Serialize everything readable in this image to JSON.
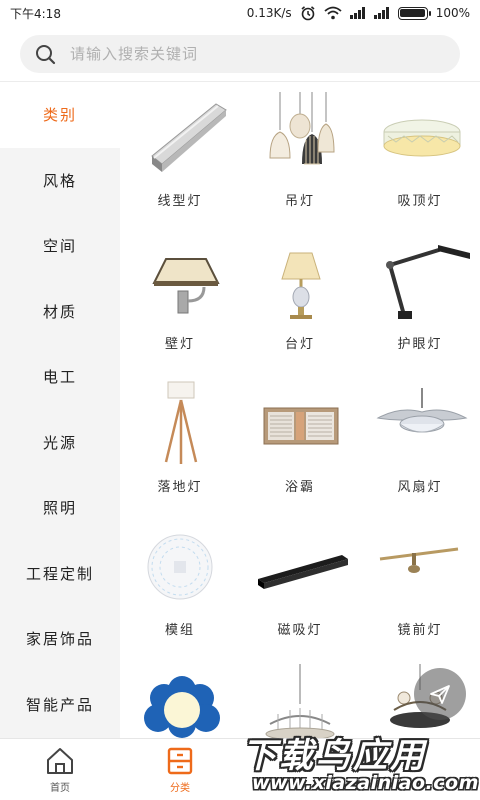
{
  "status_bar": {
    "time": "下午4:18",
    "net_speed": "0.13K/s",
    "battery_text": "100%",
    "battery_level": 1.0
  },
  "search": {
    "placeholder": "请输入搜索关键词"
  },
  "sidebar": {
    "items": [
      {
        "label": "类别",
        "active": true
      },
      {
        "label": "风格"
      },
      {
        "label": "空间"
      },
      {
        "label": "材质"
      },
      {
        "label": "电工"
      },
      {
        "label": "光源"
      },
      {
        "label": "照明"
      },
      {
        "label": "工程定制"
      },
      {
        "label": "家居饰品"
      },
      {
        "label": "智能产品"
      }
    ]
  },
  "products": [
    {
      "label": "线型灯",
      "icon": "linear-light-icon"
    },
    {
      "label": "吊灯",
      "icon": "pendant-light-icon"
    },
    {
      "label": "吸顶灯",
      "icon": "ceiling-light-icon"
    },
    {
      "label": "壁灯",
      "icon": "wall-lamp-icon"
    },
    {
      "label": "台灯",
      "icon": "table-lamp-icon"
    },
    {
      "label": "护眼灯",
      "icon": "desk-arm-lamp-icon"
    },
    {
      "label": "落地灯",
      "icon": "floor-lamp-icon"
    },
    {
      "label": "浴霸",
      "icon": "bath-heater-icon"
    },
    {
      "label": "风扇灯",
      "icon": "fan-light-icon"
    },
    {
      "label": "模组",
      "icon": "led-module-icon"
    },
    {
      "label": "磁吸灯",
      "icon": "magnetic-track-icon"
    },
    {
      "label": "镜前灯",
      "icon": "mirror-light-icon"
    },
    {
      "label": "",
      "icon": "kids-light-icon"
    },
    {
      "label": "",
      "icon": "chandelier-icon"
    },
    {
      "label": "",
      "icon": "crystal-chandelier-icon"
    }
  ],
  "bottom_nav": [
    {
      "label": "首页",
      "icon": "home-icon",
      "active": false
    },
    {
      "label": "分类",
      "icon": "category-icon",
      "active": true
    }
  ],
  "watermark": {
    "title": "下载鸟应用",
    "url": "www.xiazainiao.com"
  },
  "colors": {
    "accent": "#ee6a1a",
    "sidebar_bg": "#f4f4f4"
  }
}
